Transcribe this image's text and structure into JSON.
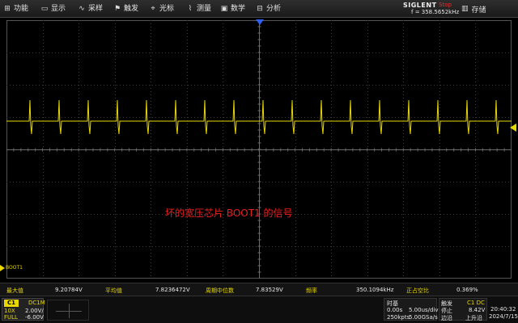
{
  "menu": {
    "items": [
      {
        "label": "功能",
        "icon": "function-icon",
        "glyph": "⊞"
      },
      {
        "label": "显示",
        "icon": "display-icon",
        "glyph": "▭"
      },
      {
        "label": "采样",
        "icon": "acquire-icon",
        "glyph": "∿"
      },
      {
        "label": "触发",
        "icon": "trigger-icon",
        "glyph": "⚑"
      },
      {
        "label": "光标",
        "icon": "cursor-icon",
        "glyph": "⌖"
      },
      {
        "label": "测量",
        "icon": "measure-icon",
        "glyph": "⌇"
      },
      {
        "label": "数学",
        "icon": "math-icon",
        "glyph": "▣"
      },
      {
        "label": "分析",
        "icon": "analysis-icon",
        "glyph": "⊟"
      }
    ],
    "brand": "SIGLENT",
    "run_state": "Stop",
    "frequency": "f = 358.5652kHz",
    "save": {
      "label": "存储",
      "icon": "save-icon",
      "glyph": "▥"
    }
  },
  "screen": {
    "annotation": "坏的宽压芯片 BOOT1 的信号",
    "channel_marker": "BOOT1",
    "trace_color": "#e8d800",
    "grid_color": "#3a3a3a"
  },
  "measurements": [
    {
      "label": "最大值",
      "value": "9.20784V"
    },
    {
      "label": "平均值",
      "value": "7.8236472V"
    },
    {
      "label": "周期中位数",
      "value": "7.83529V"
    },
    {
      "label": "频率",
      "value": "350.1094kHz"
    },
    {
      "label": "正占空比",
      "value": "0.369%"
    }
  ],
  "channel": {
    "tag": "C1",
    "coupling": "DC1M",
    "probe": "10X",
    "scale": "2.00V/",
    "bandwidth": "FULL",
    "offset": "-6.00V"
  },
  "timebase": {
    "title": "时基",
    "delay": "0.00s",
    "scale": "5.00us/div",
    "memory": "250kpts",
    "sample_rate": "5.00GSa/s"
  },
  "trigger": {
    "title": "触发",
    "source": "C1 DC",
    "mode": "停止",
    "level": "8.42V",
    "type": "边沿",
    "slope": "上升沿"
  },
  "clock": {
    "time": "20:40:32",
    "date": "2024/7/15"
  }
}
